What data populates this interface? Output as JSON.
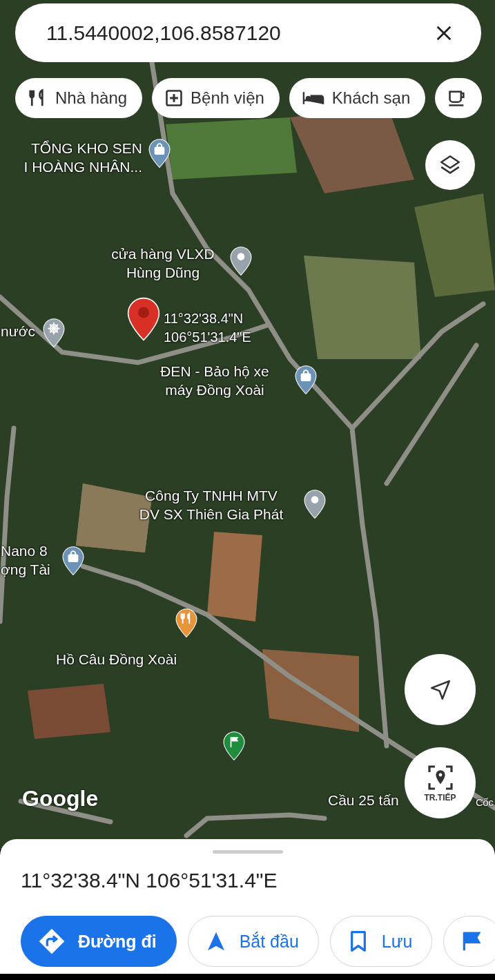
{
  "search": {
    "value": "11.5440002,106.8587120"
  },
  "chips": [
    {
      "label": "Nhà hàng",
      "kind": "restaurant"
    },
    {
      "label": "Bệnh viện",
      "kind": "hospital"
    },
    {
      "label": "Khách sạn",
      "kind": "hotel"
    },
    {
      "kind": "cafe"
    }
  ],
  "places": [
    {
      "kind": "shopping",
      "lines": [
        "TỔNG KHO SEN",
        "I HOÀNG NHÂN..."
      ]
    },
    {
      "kind": "place",
      "lines": [
        "cửa hàng VLXD",
        "Hùng Dũng"
      ]
    },
    {
      "kind": "helm",
      "lines": [
        "nước"
      ]
    },
    {
      "kind": "dropped",
      "lines": [
        "11°32'38.4\"N",
        "106°51'31.4\"E"
      ]
    },
    {
      "kind": "shopping",
      "lines": [
        "ĐEN - Bảo hộ xe",
        "máy Đồng Xoài"
      ]
    },
    {
      "kind": "place",
      "lines": [
        "Công Ty TNHH MTV",
        "DV SX Thiên Gia Phát"
      ]
    },
    {
      "kind": "shopping",
      "lines": [
        "Nano 8",
        "ợng Tài"
      ]
    },
    {
      "kind": "restaurant",
      "lines": [
        "Hồ Câu Đồng Xoài"
      ]
    },
    {
      "kind": "flag"
    },
    {
      "kind": "none",
      "lines": [
        "Cầu 25 tấn"
      ]
    },
    {
      "kind": "none",
      "lines": [
        "Cốc"
      ]
    }
  ],
  "map_logo": "Google",
  "live_view_button": {
    "label": "TR.TIẾP"
  },
  "sheet": {
    "title": "11°32'38.4\"N 106°51'31.4\"E",
    "actions": [
      {
        "label": "Đường đi",
        "kind": "directions",
        "primary": true
      },
      {
        "label": "Bắt đầu",
        "kind": "start",
        "primary": false
      },
      {
        "label": "Lưu",
        "kind": "save",
        "primary": false
      },
      {
        "kind": "flag",
        "primary": false
      }
    ]
  }
}
